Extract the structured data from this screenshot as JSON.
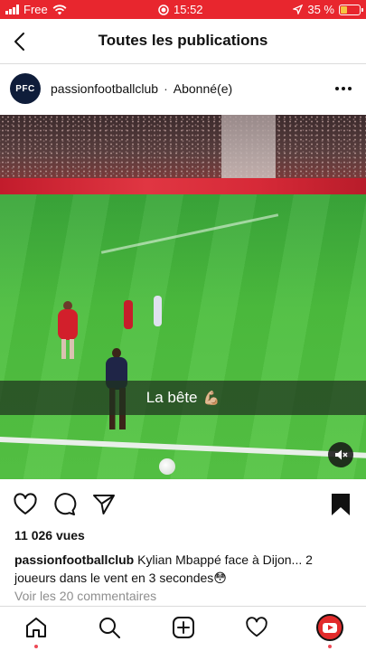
{
  "status_bar": {
    "carrier": "Free",
    "time": "15:52",
    "battery": "35 %",
    "battery_level": 0.35,
    "color": "#e8262e"
  },
  "header": {
    "back_icon": "chevron-left-icon",
    "title": "Toutes les publications"
  },
  "post": {
    "avatar_text": "PFC",
    "username": "passionfootballclub",
    "separator": "·",
    "follow_status": "Abonné(e)",
    "more_icon": "more-horizontal-icon",
    "video_caption": "La bête",
    "video_caption_emoji": "💪🏼",
    "mute_icon": "speaker-muted-icon"
  },
  "actions": {
    "like_icon": "heart-icon",
    "comment_icon": "comment-icon",
    "share_icon": "send-icon",
    "save_icon": "bookmark-filled-icon"
  },
  "stats": {
    "views": "11 026 vues"
  },
  "caption": {
    "username": "passionfootballclub",
    "text": "Kylian Mbappé face à Dijon... 2 joueurs dans le vent en 3 secondes😳"
  },
  "comments": {
    "view_all": "Voir les 20 commentaires"
  },
  "bottom_nav": {
    "items": [
      "home-icon",
      "search-icon",
      "new-post-icon",
      "activity-heart-icon",
      "profile-avatar"
    ],
    "notification_color": "#ed4956"
  }
}
